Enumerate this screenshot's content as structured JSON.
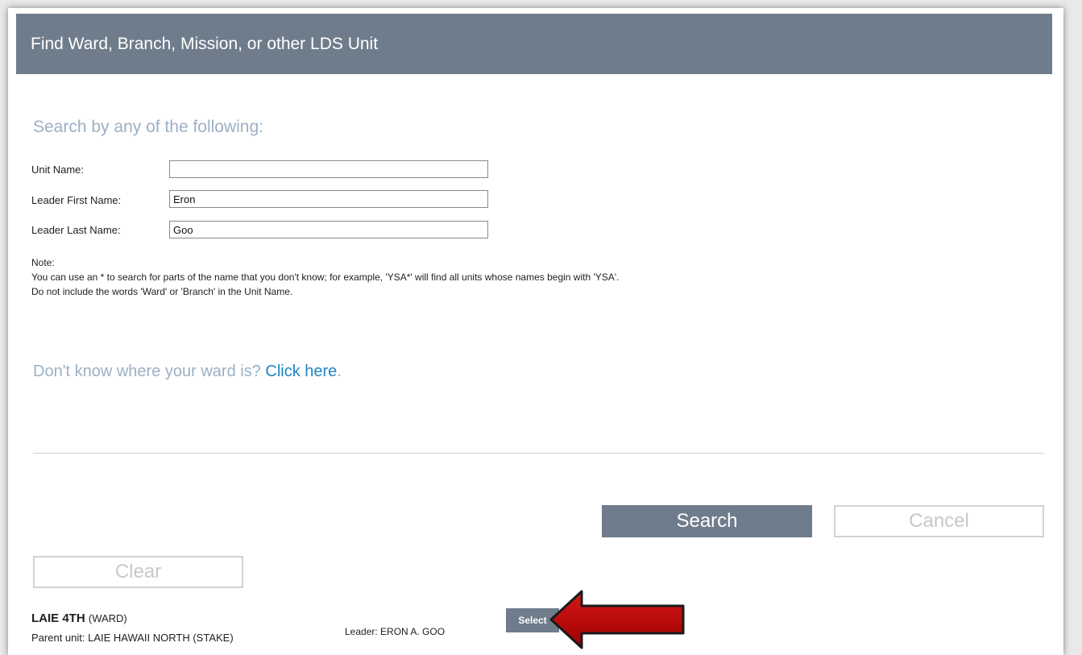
{
  "header": {
    "title": "Find Ward, Branch, Mission, or other LDS Unit"
  },
  "search": {
    "heading": "Search by any of the following:",
    "fields": [
      {
        "label": "Unit Name:",
        "value": ""
      },
      {
        "label": "Leader First Name:",
        "value": "Eron"
      },
      {
        "label": "Leader Last Name:",
        "value": "Goo"
      }
    ]
  },
  "note": {
    "title": "Note:",
    "line1": "You can use an * to search for parts of the name that you don't know; for example, 'YSA*' will find all units whose names begin with 'YSA'.",
    "line2": "Do not include the words 'Ward' or 'Branch' in the Unit Name."
  },
  "help": {
    "text": "Don't know where your ward is? ",
    "link": "Click here",
    "suffix": "."
  },
  "buttons": {
    "search": "Search",
    "cancel": "Cancel",
    "clear": "Clear"
  },
  "result": {
    "unit_name": "LAIE 4TH",
    "unit_type": "(WARD)",
    "parent": "Parent unit: LAIE HAWAII NORTH (STAKE)",
    "leader": "Leader: ERON A. GOO",
    "select_label": "Select"
  },
  "colors": {
    "header_bg": "#6f7c8b",
    "link": "#1e86c2",
    "heading": "#9cb0c4",
    "arrow": "#c00000"
  },
  "icons": {
    "annotation": "red-arrow-icon"
  }
}
